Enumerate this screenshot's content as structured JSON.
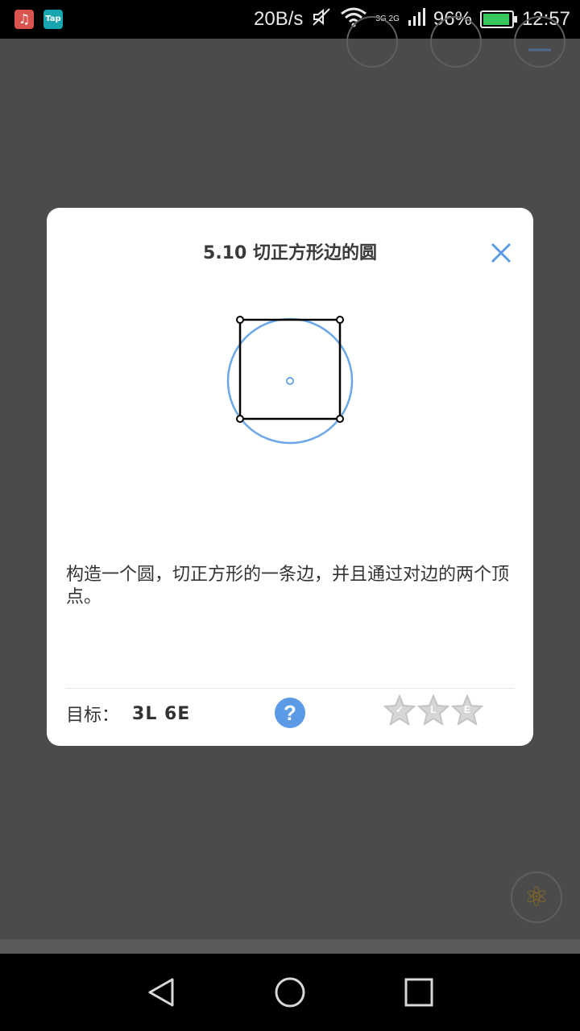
{
  "status_bar": {
    "net_speed": "20B/s",
    "network_types": "3G 2G",
    "battery": "96%",
    "battery_level": 0.96,
    "time": "12:57",
    "app_icons": [
      "music-icon",
      "taptap-icon"
    ],
    "tap_label": "Tap"
  },
  "dialog": {
    "title": "5.10 切正方形边的圆",
    "description": "构造一个圆，切正方形的一条边，并且通过对边的两个顶点。",
    "goal_label": "目标：",
    "goal_value": "3L 6E",
    "help_label": "?",
    "stars": [
      "✓",
      "L",
      "E"
    ],
    "colors": {
      "accent": "#5b9be6",
      "circle": "#6aa8ea",
      "square": "#000000"
    }
  },
  "navigation": {
    "buttons": [
      "back-icon",
      "home-icon",
      "recents-icon"
    ]
  }
}
